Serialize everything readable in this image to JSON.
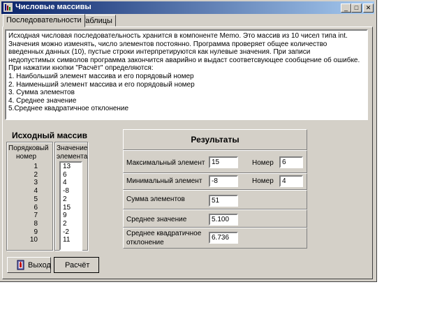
{
  "window": {
    "title": "Числовые массивы"
  },
  "titlebar_buttons": {
    "minimize": "_",
    "maximize": "□",
    "close": "✕"
  },
  "tabs": [
    {
      "label": "Последовательности"
    },
    {
      "label": "Таблицы"
    }
  ],
  "memo": {
    "lines": [
      "Исходная числовая последовательность  хранится  в компоненте Memo.  Это массив  из 10 чисел типа int.",
      "Значения можно изменять, число элементов постоянно.  Программа проверяет общее количество",
      "введенных данных (10),  пустые строки интерпретируются как нулевые значения. При записи",
      "недопустимых символов программа  закончится  аварийно и выдаст соответсвующее сообщение об ошибке.",
      "При нажатии  кнопки \"Расчёт\" определяются:",
      "1. Наибольший элемент массива и его порядовый номер",
      "2. Наименьший элемент массива и его порядовый номер",
      "3. Сумма элементов",
      "4. Среднее значение",
      "5.Среднее квадратичное отклонение"
    ]
  },
  "source_array": {
    "title": "Исходный  массив",
    "col_index_header_1": "Порядковый",
    "col_index_header_2": "номер",
    "col_value_header_1": "Значение",
    "col_value_header_2": "элемента",
    "indices": [
      "1",
      "2",
      "3",
      "4",
      "5",
      "6",
      "7",
      "8",
      "9",
      "10"
    ],
    "values": [
      "13",
      "6",
      "4",
      "-8",
      "2",
      "15",
      "9",
      "2",
      "-2",
      "11"
    ]
  },
  "results": {
    "title": "Результаты",
    "max_label": "Максимальный элемент",
    "max_value": "15",
    "max_num_label": "Номер",
    "max_num_value": "6",
    "min_label": "Минимальный элемент",
    "min_value": "-8",
    "min_num_label": "Номер",
    "min_num_value": "4",
    "sum_label": "Сумма элементов",
    "sum_value": "51",
    "avg_label": "Среднее  значение",
    "avg_value": "5.100",
    "std_label_1": "Среднее  квадратичное",
    "std_label_2": "отклонение",
    "std_value": "6.736"
  },
  "buttons": {
    "exit_label": "Выход",
    "calc_label": "Расчёт"
  }
}
